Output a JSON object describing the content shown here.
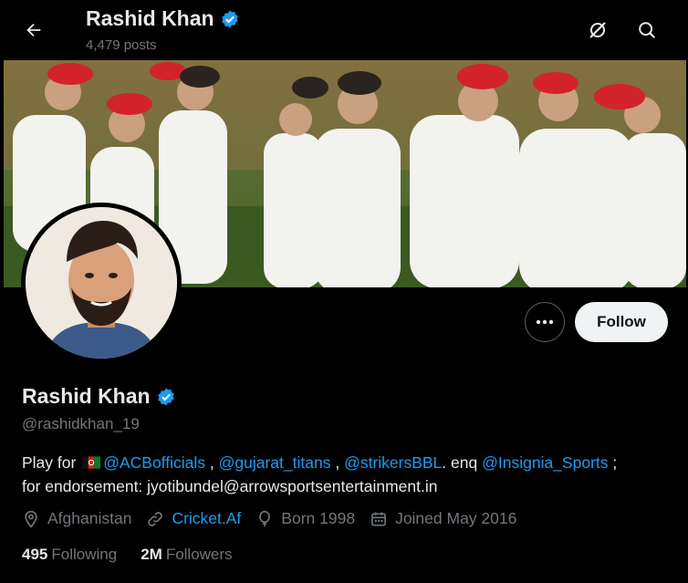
{
  "header": {
    "name": "Rashid Khan",
    "posts": "4,479 posts"
  },
  "profile": {
    "name": "Rashid Khan",
    "handle": "@rashidkhan_19",
    "follow_label": "Follow",
    "bio": {
      "prefix": "Play for",
      "link1": "@ACBofficials",
      "sep1": " ,",
      "link2": "@gujarat_titans",
      "sep2": " ,",
      "link3": "@strikersBBL",
      "mid": ". enq",
      "link4": "@Insignia_Sports",
      "tail": " ;",
      "line2": "for endorsement: jyotibundel@arrowsportsentertainment.in"
    },
    "location": "Afghanistan",
    "website": "Cricket.Af",
    "born": "Born 1998",
    "joined": "Joined May 2016",
    "following_count": "495",
    "following_label": "Following",
    "followers_count": "2M",
    "followers_label": "Followers"
  },
  "colors": {
    "accent": "#1d9bf0",
    "muted": "#71767b",
    "background": "#000000"
  },
  "icons": [
    "back-arrow-icon",
    "verified-badge-icon",
    "grok-icon",
    "search-icon",
    "more-icon",
    "location-icon",
    "link-icon",
    "balloon-icon",
    "calendar-icon",
    "flag-icon"
  ]
}
